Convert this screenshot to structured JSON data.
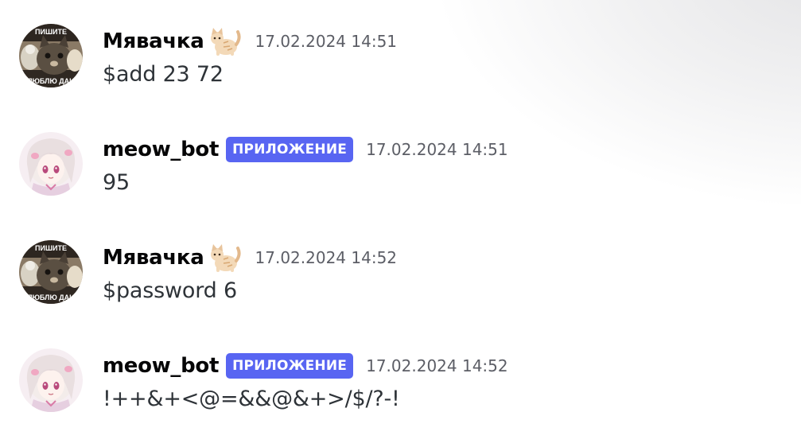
{
  "messages": [
    {
      "author": "Мявачка",
      "author_emoji": "cat-emoji",
      "badge": "",
      "timestamp": "17.02.2024 14:51",
      "text": "$add 23 72"
    },
    {
      "author": "meow_bot",
      "badge": "ПРИЛОЖЕНИЕ",
      "timestamp": "17.02.2024 14:51",
      "text": "95"
    },
    {
      "author": "Мявачка",
      "author_emoji": "cat-emoji",
      "badge": "",
      "timestamp": "17.02.2024 14:52",
      "text": "$password 6"
    },
    {
      "author": "meow_bot",
      "badge": "ПРИЛОЖЕНИЕ",
      "timestamp": "17.02.2024 14:52",
      "text": "!++&+<@=&&@&+>/$/?-!"
    }
  ],
  "avatar_text": {
    "top": "ПИШИТЕ",
    "bottom": "ЛЮБЛЮ ДАН"
  },
  "colors": {
    "badge": "#5865f2",
    "username": "#060607",
    "timestamp": "#5c5e66",
    "text": "#2e3338"
  }
}
